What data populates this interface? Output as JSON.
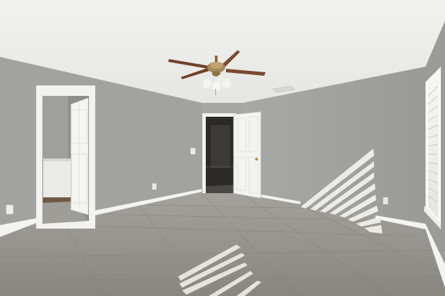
{
  "scene": {
    "subject": "empty room",
    "palette": {
      "ceiling": "#ececea",
      "wall": "#a3a3a1",
      "wall_light": "#acacaa",
      "floor": "#8f8e88",
      "trim": "#f3f3f0",
      "door": "#f1f1ee",
      "fan_blade": "#7a4a30",
      "sunlight": "#f4f4ee"
    },
    "icons": {
      "ceiling_fan": "ceiling-fan-icon",
      "air_vent": "air-vent-icon",
      "outlet": "wall-outlet-icon",
      "light_switch": "light-switch-icon"
    }
  }
}
